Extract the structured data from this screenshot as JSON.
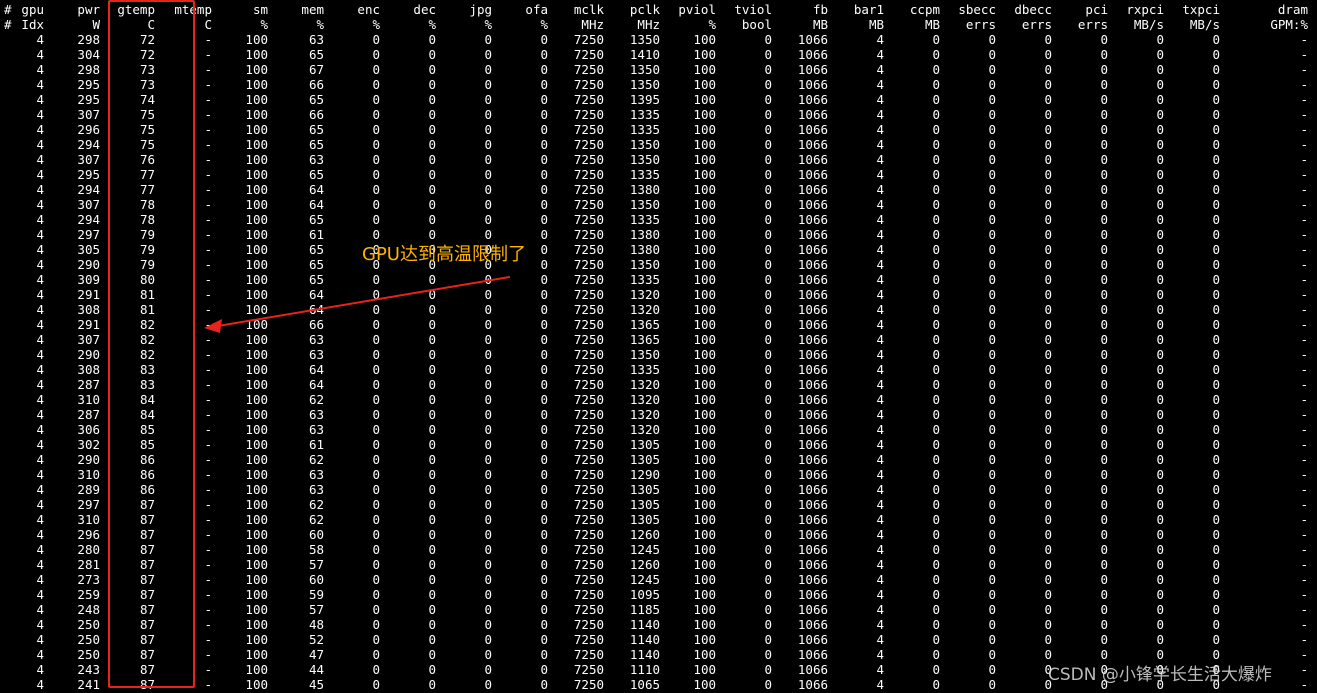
{
  "header": {
    "line1": [
      "gpu",
      "pwr",
      "gtemp",
      "mtemp",
      "sm",
      "mem",
      "enc",
      "dec",
      "jpg",
      "ofa",
      "mclk",
      "pclk",
      "pviol",
      "tviol",
      "fb",
      "bar1",
      "ccpm",
      "sbecc",
      "dbecc",
      "pci",
      "rxpci",
      "txpci",
      "dram"
    ],
    "line2": [
      "Idx",
      "W",
      "C",
      "C",
      "%",
      "%",
      "%",
      "%",
      "%",
      "%",
      "MHz",
      "MHz",
      "%",
      "bool",
      "MB",
      "MB",
      "MB",
      "errs",
      "errs",
      "errs",
      "MB/s",
      "MB/s",
      "GPM:%"
    ],
    "hash": "#"
  },
  "rows": [
    [
      298,
      72,
      100,
      63,
      1350
    ],
    [
      304,
      72,
      100,
      65,
      1410
    ],
    [
      298,
      73,
      100,
      67,
      1350
    ],
    [
      295,
      73,
      100,
      66,
      1350
    ],
    [
      295,
      74,
      100,
      65,
      1395
    ],
    [
      307,
      75,
      100,
      66,
      1335
    ],
    [
      296,
      75,
      100,
      65,
      1335
    ],
    [
      294,
      75,
      100,
      65,
      1350
    ],
    [
      307,
      76,
      100,
      63,
      1350
    ],
    [
      295,
      77,
      100,
      65,
      1335
    ],
    [
      294,
      77,
      100,
      64,
      1380
    ],
    [
      307,
      78,
      100,
      64,
      1350
    ],
    [
      294,
      78,
      100,
      65,
      1335
    ],
    [
      297,
      79,
      100,
      61,
      1380
    ],
    [
      305,
      79,
      100,
      65,
      1380
    ],
    [
      290,
      79,
      100,
      65,
      1350
    ],
    [
      309,
      80,
      100,
      65,
      1335
    ],
    [
      291,
      81,
      100,
      64,
      1320
    ],
    [
      308,
      81,
      100,
      64,
      1320
    ],
    [
      291,
      82,
      100,
      66,
      1365
    ],
    [
      307,
      82,
      100,
      63,
      1365
    ],
    [
      290,
      82,
      100,
      63,
      1350
    ],
    [
      308,
      83,
      100,
      64,
      1335
    ],
    [
      287,
      83,
      100,
      64,
      1320
    ],
    [
      310,
      84,
      100,
      62,
      1320
    ],
    [
      287,
      84,
      100,
      63,
      1320
    ],
    [
      306,
      85,
      100,
      63,
      1320
    ],
    [
      302,
      85,
      100,
      61,
      1305
    ],
    [
      290,
      86,
      100,
      62,
      1305
    ],
    [
      310,
      86,
      100,
      63,
      1290
    ],
    [
      289,
      86,
      100,
      63,
      1305
    ],
    [
      297,
      87,
      100,
      62,
      1305
    ],
    [
      310,
      87,
      100,
      62,
      1305
    ],
    [
      296,
      87,
      100,
      60,
      1260
    ],
    [
      280,
      87,
      100,
      58,
      1245
    ],
    [
      281,
      87,
      100,
      57,
      1260
    ],
    [
      273,
      87,
      100,
      60,
      1245
    ],
    [
      259,
      87,
      100,
      59,
      1095
    ],
    [
      248,
      87,
      100,
      57,
      1185
    ],
    [
      250,
      87,
      100,
      48,
      1140
    ],
    [
      250,
      87,
      100,
      52,
      1140
    ],
    [
      250,
      87,
      100,
      47,
      1140
    ],
    [
      243,
      87,
      100,
      44,
      1110
    ],
    [
      241,
      87,
      100,
      45,
      1065
    ]
  ],
  "constants": {
    "idx": "4",
    "mtemp": "-",
    "enc": "0",
    "dec": "0",
    "jpg": "0",
    "ofa": "0",
    "mclk": "7250",
    "pviol": "100",
    "tviol": "0",
    "fb": "1066",
    "bar1": "4",
    "ccpm": "0",
    "sbecc": "0",
    "dbecc": "0",
    "pci": "0",
    "rxpci": "0",
    "txpci": "0",
    "dram": "-"
  },
  "annotation": {
    "text": "GPU达到高温限制了",
    "color": "#ffb300",
    "box_color": "#e8231c"
  },
  "watermark": "CSDN @小锋学长生活大爆炸"
}
